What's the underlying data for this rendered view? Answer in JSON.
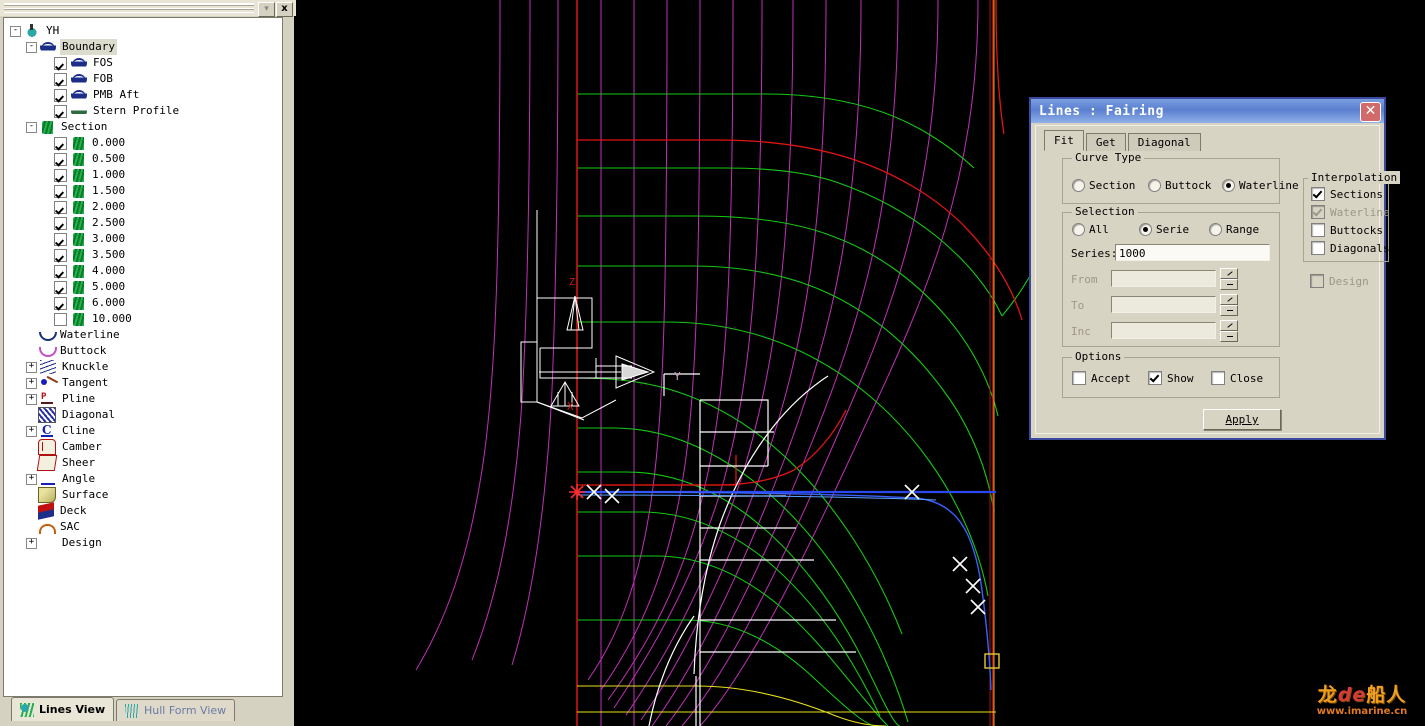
{
  "dock": {
    "close_label": "x",
    "dropdown_label": "▾",
    "tree": {
      "root": {
        "label": "YH",
        "icon": "ship-icon",
        "expander": "-"
      },
      "items": [
        {
          "label": "Boundary",
          "icon": "boundary-icon",
          "expander": "-",
          "selected": true,
          "indent": 1
        },
        {
          "label": "FOS",
          "icon": "boundary-icon",
          "checkbox": true,
          "indent": 2
        },
        {
          "label": "FOB",
          "icon": "boundary-icon",
          "checkbox": true,
          "indent": 2
        },
        {
          "label": "PMB Aft",
          "icon": "boundary-icon",
          "checkbox": true,
          "indent": 2
        },
        {
          "label": "Stern Profile",
          "icon": "stern-profile-icon",
          "checkbox": true,
          "indent": 2
        },
        {
          "label": "Section",
          "icon": "section-icon",
          "expander": "-",
          "indent": 1
        },
        {
          "label": "0.000",
          "icon": "section-icon",
          "checkbox": true,
          "indent": 2
        },
        {
          "label": "0.500",
          "icon": "section-icon",
          "checkbox": true,
          "indent": 2
        },
        {
          "label": "1.000",
          "icon": "section-icon",
          "checkbox": true,
          "indent": 2
        },
        {
          "label": "1.500",
          "icon": "section-icon",
          "checkbox": true,
          "indent": 2
        },
        {
          "label": "2.000",
          "icon": "section-icon",
          "checkbox": true,
          "indent": 2
        },
        {
          "label": "2.500",
          "icon": "section-icon",
          "checkbox": true,
          "indent": 2
        },
        {
          "label": "3.000",
          "icon": "section-icon",
          "checkbox": true,
          "indent": 2
        },
        {
          "label": "3.500",
          "icon": "section-icon",
          "checkbox": true,
          "indent": 2
        },
        {
          "label": "4.000",
          "icon": "section-icon",
          "checkbox": true,
          "indent": 2
        },
        {
          "label": "5.000",
          "icon": "section-icon",
          "checkbox": true,
          "indent": 2
        },
        {
          "label": "6.000",
          "icon": "section-icon",
          "checkbox": true,
          "indent": 2
        },
        {
          "label": "10.000",
          "icon": "section-icon",
          "checkbox": false,
          "indent": 2
        },
        {
          "label": "Waterline",
          "icon": "waterline-icon",
          "indent": 1
        },
        {
          "label": "Buttock",
          "icon": "buttock-icon",
          "indent": 1
        },
        {
          "label": "Knuckle",
          "icon": "knuckle-icon",
          "expander": "+",
          "indent": 1
        },
        {
          "label": "Tangent",
          "icon": "tangent-icon",
          "expander": "+",
          "indent": 1
        },
        {
          "label": "Pline",
          "icon": "pline-icon",
          "expander": "+",
          "indent": 1
        },
        {
          "label": "Diagonal",
          "icon": "diagonal-icon",
          "indent": 1
        },
        {
          "label": "Cline",
          "icon": "cline-icon",
          "expander": "+",
          "indent": 1
        },
        {
          "label": "Camber",
          "icon": "camber-icon",
          "indent": 1
        },
        {
          "label": "Sheer",
          "icon": "sheer-icon",
          "indent": 1
        },
        {
          "label": "Angle",
          "icon": "angle-icon",
          "expander": "+",
          "indent": 1
        },
        {
          "label": "Surface",
          "icon": "surface-icon",
          "indent": 1
        },
        {
          "label": "Deck",
          "icon": "deck-icon",
          "indent": 1
        },
        {
          "label": "SAC",
          "icon": "sac-icon",
          "indent": 1
        },
        {
          "label": "Design",
          "icon": "design-icon",
          "expander": "+",
          "indent": 1
        }
      ]
    },
    "view_tabs": [
      {
        "label": "Lines View",
        "icon": "lines-view-icon",
        "active": true
      },
      {
        "label": "Hull Form View",
        "icon": "hull-form-view-icon",
        "active": false
      }
    ]
  },
  "dialog": {
    "title": "Lines : Fairing",
    "close_label": "✕",
    "tabs": [
      {
        "label": "Fit",
        "active": true
      },
      {
        "label": "Get",
        "active": false
      },
      {
        "label": "Diagonal",
        "active": false
      }
    ],
    "curve_type": {
      "legend": "Curve Type",
      "options": [
        {
          "label": "Section",
          "selected": false
        },
        {
          "label": "Buttock",
          "selected": false
        },
        {
          "label": "Waterline",
          "selected": true
        }
      ]
    },
    "selection": {
      "legend": "Selection",
      "modes": [
        {
          "label": "All",
          "selected": false
        },
        {
          "label": "Serie",
          "selected": true
        },
        {
          "label": "Range",
          "selected": false
        }
      ],
      "series_label": "Series",
      "series_value": "1000",
      "from_label": "From",
      "from_value": "",
      "to_label": "To",
      "to_value": "",
      "inc_label": "Inc",
      "inc_value": ""
    },
    "options": {
      "legend": "Options",
      "items": [
        {
          "label": "Accept",
          "checked": false
        },
        {
          "label": "Show",
          "checked": true
        },
        {
          "label": "Close",
          "checked": false
        }
      ]
    },
    "interpolation": {
      "legend": "Interpolation",
      "items": [
        {
          "label": "Sections",
          "checked": true,
          "disabled": false
        },
        {
          "label": "Waterline",
          "checked": true,
          "disabled": true
        },
        {
          "label": "Buttocks",
          "checked": false,
          "disabled": false
        },
        {
          "label": "Diagonals",
          "checked": false,
          "disabled": false
        }
      ],
      "design": {
        "label": "Design",
        "checked": false,
        "disabled": true
      }
    },
    "apply_label": "Apply"
  },
  "viewport": {
    "axis_labels": {
      "x": "X",
      "y": "Y",
      "z": "Z"
    },
    "colors": {
      "background": "#000000",
      "sections": "#00c800",
      "buttocks": "#c838c8",
      "boundary": "#d01818",
      "stern_profile": "#ffffff",
      "active_waterline": "#2a48f0",
      "deck": "#f0f030",
      "marker": "#ffffff",
      "selection_box": "#e8c832"
    }
  },
  "watermark": {
    "line1_a": "龙",
    "line1_b": "de",
    "line1_c": "船人",
    "line2": "www.imarine.cn"
  }
}
